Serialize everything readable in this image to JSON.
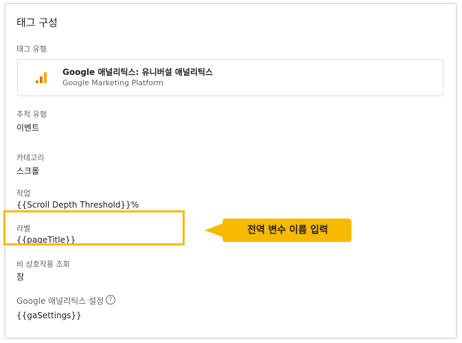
{
  "card": {
    "title": "태그 구성",
    "tag_type_label": "태그 유형",
    "tag": {
      "name": "Google 애널리틱스: 유니버설 애널리틱스",
      "platform": "Google Marketing Platform",
      "icon": "google-analytics-icon"
    },
    "track_type": {
      "label": "추적 유형",
      "value": "이벤트"
    },
    "category": {
      "label": "카테고리",
      "value": "스크롤"
    },
    "action": {
      "label": "작업",
      "value": "{{Scroll Depth Threshold}}%"
    },
    "label": {
      "label": "라벨",
      "value": "{{pageTitle}}"
    },
    "non_interaction": {
      "label": "비 상호작용 조회",
      "value": "참"
    },
    "ga_settings": {
      "label": "Google 애널리틱스 설정",
      "value": "{{gaSettings}}",
      "help_icon": "?"
    }
  },
  "annotation": {
    "callout_text": "전역 변수 이름 입력",
    "color": "#f9b900"
  }
}
